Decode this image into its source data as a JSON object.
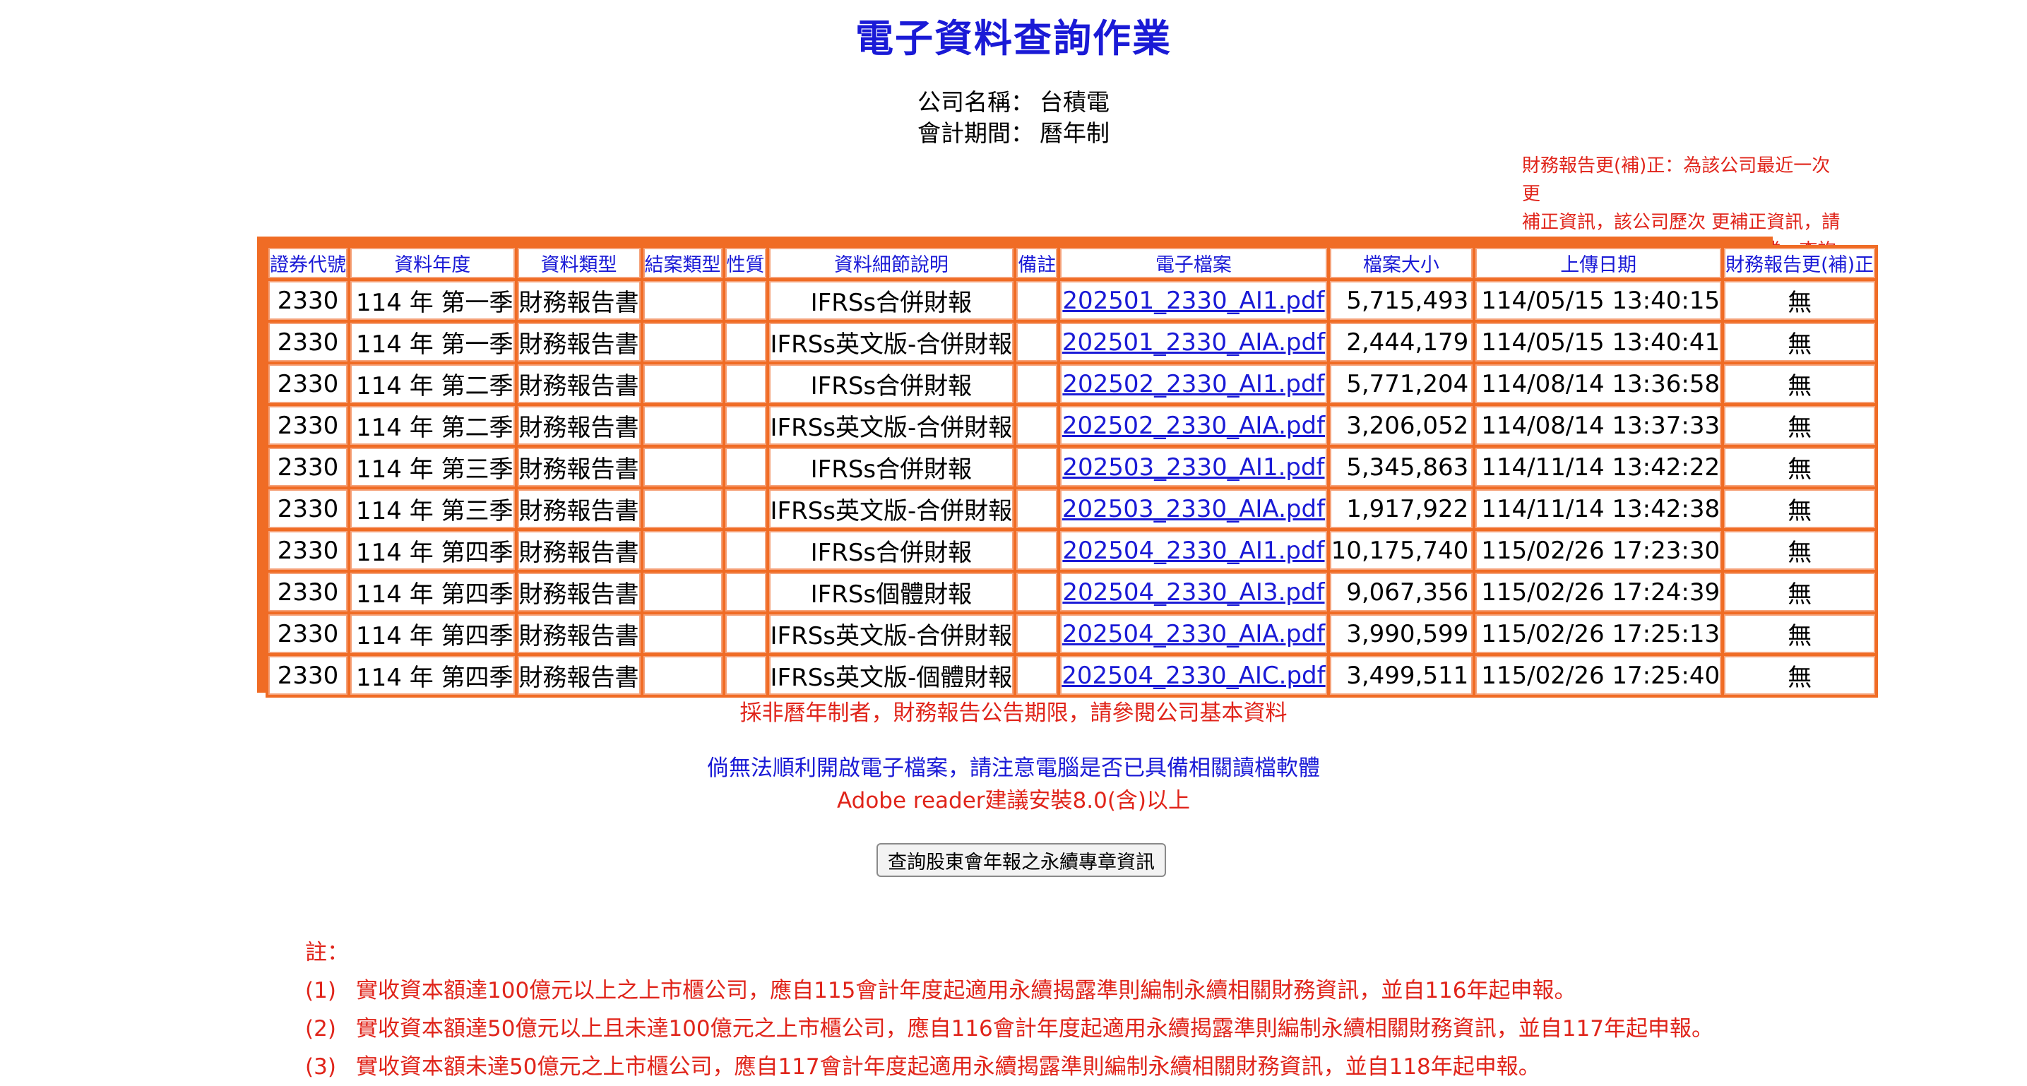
{
  "title": "電子資料查詢作業",
  "company": {
    "label": "公司名稱：",
    "value": "台積電"
  },
  "period": {
    "label": "會計期間：",
    "value": "曆年制"
  },
  "correction_note": [
    "財務報告更(補)正：為該公司最近一次更",
    "補正資訊，該公司歷次 更補正資訊，請",
    "至「財務報告更(補)正 查詢作業」查詢"
  ],
  "table": {
    "headers": [
      "證券代號",
      "資料年度",
      "資料類型",
      "結案類型",
      "性質",
      "資料細節說明",
      "備註",
      "電子檔案",
      "檔案大小",
      "上傳日期",
      "財務報告更(補)正"
    ],
    "rows": [
      {
        "code": "2330",
        "year": "114 年 第一季",
        "type": "財務報告書",
        "close": "",
        "nature": "",
        "detail": "IFRSs合併財報",
        "remark": "",
        "file": "202501_2330_AI1.pdf",
        "size": "5,715,493",
        "date": "114/05/15 13:40:15",
        "correction": "無"
      },
      {
        "code": "2330",
        "year": "114 年 第一季",
        "type": "財務報告書",
        "close": "",
        "nature": "",
        "detail": "IFRSs英文版-合併財報",
        "remark": "",
        "file": "202501_2330_AIA.pdf",
        "size": "2,444,179",
        "date": "114/05/15 13:40:41",
        "correction": "無"
      },
      {
        "code": "2330",
        "year": "114 年 第二季",
        "type": "財務報告書",
        "close": "",
        "nature": "",
        "detail": "IFRSs合併財報",
        "remark": "",
        "file": "202502_2330_AI1.pdf",
        "size": "5,771,204",
        "date": "114/08/14 13:36:58",
        "correction": "無"
      },
      {
        "code": "2330",
        "year": "114 年 第二季",
        "type": "財務報告書",
        "close": "",
        "nature": "",
        "detail": "IFRSs英文版-合併財報",
        "remark": "",
        "file": "202502_2330_AIA.pdf",
        "size": "3,206,052",
        "date": "114/08/14 13:37:33",
        "correction": "無"
      },
      {
        "code": "2330",
        "year": "114 年 第三季",
        "type": "財務報告書",
        "close": "",
        "nature": "",
        "detail": "IFRSs合併財報",
        "remark": "",
        "file": "202503_2330_AI1.pdf",
        "size": "5,345,863",
        "date": "114/11/14 13:42:22",
        "correction": "無"
      },
      {
        "code": "2330",
        "year": "114 年 第三季",
        "type": "財務報告書",
        "close": "",
        "nature": "",
        "detail": "IFRSs英文版-合併財報",
        "remark": "",
        "file": "202503_2330_AIA.pdf",
        "size": "1,917,922",
        "date": "114/11/14 13:42:38",
        "correction": "無"
      },
      {
        "code": "2330",
        "year": "114 年 第四季",
        "type": "財務報告書",
        "close": "",
        "nature": "",
        "detail": "IFRSs合併財報",
        "remark": "",
        "file": "202504_2330_AI1.pdf",
        "size": "10,175,740",
        "date": "115/02/26 17:23:30",
        "correction": "無"
      },
      {
        "code": "2330",
        "year": "114 年 第四季",
        "type": "財務報告書",
        "close": "",
        "nature": "",
        "detail": "IFRSs個體財報",
        "remark": "",
        "file": "202504_2330_AI3.pdf",
        "size": "9,067,356",
        "date": "115/02/26 17:24:39",
        "correction": "無"
      },
      {
        "code": "2330",
        "year": "114 年 第四季",
        "type": "財務報告書",
        "close": "",
        "nature": "",
        "detail": "IFRSs英文版-合併財報",
        "remark": "",
        "file": "202504_2330_AIA.pdf",
        "size": "3,990,599",
        "date": "115/02/26 17:25:13",
        "correction": "無"
      },
      {
        "code": "2330",
        "year": "114 年 第四季",
        "type": "財務報告書",
        "close": "",
        "nature": "",
        "detail": "IFRSs英文版-個體財報",
        "remark": "",
        "file": "202504_2330_AIC.pdf",
        "size": "3,499,511",
        "date": "115/02/26 17:25:40",
        "correction": "無"
      }
    ]
  },
  "non_calendar_note": "採非曆年制者，財務報告公告期限，請參閱公司基本資料",
  "open_file_note": "倘無法順利開啟電子檔案，請注意電腦是否已具備相關讀檔軟體",
  "adobe_note": "Adobe reader建議安裝8.0(含)以上",
  "query_button_label": "查詢股東會年報之永續專章資訊",
  "notes": {
    "heading": "註：",
    "items": [
      {
        "num": "(1)",
        "text": "實收資本額達100億元以上之上市櫃公司，應自115會計年度起適用永續揭露準則編制永續相關財務資訊，並自116年起申報。"
      },
      {
        "num": "(2)",
        "text": "實收資本額達50億元以上且未達100億元之上市櫃公司，應自116會計年度起適用永續揭露準則編制永續相關財務資訊，並自117年起申報。"
      },
      {
        "num": "(3)",
        "text": "實收資本額未達50億元之上市櫃公司，應自117會計年度起適用永續揭露準則編制永續相關財務資訊，並自118年起申報。"
      }
    ]
  },
  "colors": {
    "title_blue": "#1a1ad6",
    "note_red": "#e0241a",
    "table_orange": "#f06c25"
  }
}
